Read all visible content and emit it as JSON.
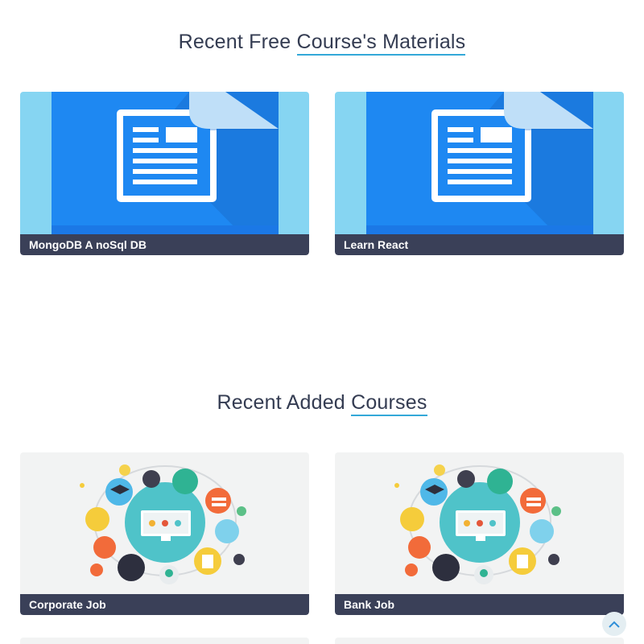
{
  "sections": {
    "materials": {
      "title_prefix": "Recent Free ",
      "title_underlined": "Course's Materials",
      "cards": [
        {
          "label": "MongoDB A noSql DB",
          "icon": "document-icon"
        },
        {
          "label": "Learn React",
          "icon": "document-icon"
        }
      ]
    },
    "courses": {
      "title_prefix": "Recent Added ",
      "title_underlined": "Courses",
      "cards": [
        {
          "label": "Corporate Job",
          "icon": "education-network-illustration"
        },
        {
          "label": "Bank Job",
          "icon": "education-network-illustration"
        }
      ]
    }
  },
  "colors": {
    "accent_underline": "#33a8d8",
    "caption_bg": "#3a4058",
    "doc_light": "#86d5f2",
    "doc_blue": "#1e88f2",
    "scroll_arrow": "#2f8fd8"
  },
  "scroll_top": {
    "icon": "chevron-up-icon"
  }
}
